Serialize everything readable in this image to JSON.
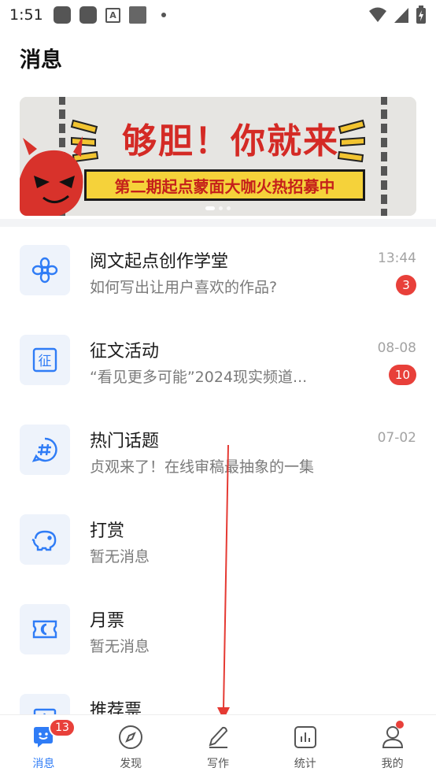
{
  "status_bar": {
    "time": "1:51",
    "notif_icon_3": "A"
  },
  "page": {
    "title": "消息"
  },
  "banner": {
    "headline": "够胆！你就来",
    "subline": "第二期起点蒙面大咖火热招募中"
  },
  "messages": [
    {
      "name": "阅文起点创作学堂",
      "preview": "如何写出让用户喜欢的作品?",
      "time": "13:44",
      "badge": "3",
      "icon": "flower-icon"
    },
    {
      "name": "征文活动",
      "preview": "“看见更多可能”2024现实频道...",
      "time": "08-08",
      "badge": "10",
      "icon": "zheng-icon"
    },
    {
      "name": "热门话题",
      "preview": "贞观来了！在线审稿最抽象的一集",
      "time": "07-02",
      "badge": "",
      "icon": "hashtag-icon"
    },
    {
      "name": "打赏",
      "preview": "暂无消息",
      "time": "",
      "badge": "",
      "icon": "piggy-bank-icon"
    },
    {
      "name": "月票",
      "preview": "暂无消息",
      "time": "",
      "badge": "",
      "icon": "moon-ticket-icon"
    },
    {
      "name": "推荐票",
      "preview": "",
      "time": "",
      "badge": "",
      "icon": "ticket-icon"
    }
  ],
  "tabs": [
    {
      "label": "消息",
      "badge": "13",
      "icon": "message-icon"
    },
    {
      "label": "发现",
      "icon": "compass-icon"
    },
    {
      "label": "写作",
      "icon": "pen-icon"
    },
    {
      "label": "统计",
      "icon": "chart-icon"
    },
    {
      "label": "我的",
      "icon": "profile-icon"
    }
  ],
  "colors": {
    "accent": "#2f7cf6",
    "badge": "#e8403a",
    "icon_bg": "#eef3fb"
  }
}
